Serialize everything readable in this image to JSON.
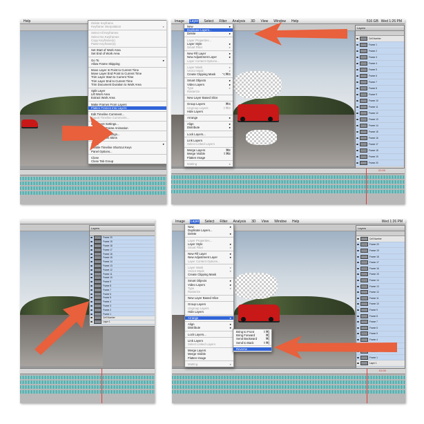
{
  "panel1": {
    "menu_items": [
      "Delete Keyframe",
      "Keyframe Interpolation",
      "Select All Keyframes",
      "Select No Keyframes",
      "Copy Keyframe(s)",
      "Paste Keyframe(s)",
      "Set Start of Work Area",
      "Set End of Work Area",
      "Go To",
      "Allow Frame Skipping",
      "Move Layer In Point to Current Time",
      "Move Layer End Point to Current Time",
      "Trim Layer Start to Current Time",
      "Trim Layer End to Current Time",
      "Trim Document Duration to Work Area",
      "Split Layer",
      "Lift Work Area",
      "Extract Work Area",
      "Make Frames From Layers",
      "Flatten Frames Into Layers",
      "Edit Timeline Comment...",
      "Export Timeline Comments...",
      "Document Settings...",
      "Convert to Frame Animation",
      "Onion Skin Settings...",
      "Enable Onion Skins",
      "Show",
      "Enable Timeline Shortcut Keys",
      "Panel Options...",
      "Close",
      "Close Tab Group"
    ],
    "highlighted": "Flatten Frames Into Layers"
  },
  "panel2": {
    "menubar": [
      "Image",
      "Layer",
      "Select",
      "Filter",
      "Analysis",
      "3D",
      "View",
      "Window",
      "Help"
    ],
    "active_menu": "Layer",
    "status_time": "Wed 1:26 PM",
    "status_size": "516 GB",
    "menu_items": [
      "New",
      "Duplicate Layers...",
      "Delete",
      "Layer Properties...",
      "Layer Style",
      "Smart Filter",
      "New Fill Layer",
      "New Adjustment Layer",
      "Layer Content Options...",
      "Layer Mask",
      "Vector Mask",
      "Create Clipping Mask",
      "Smart Objects",
      "Video Layers",
      "Type",
      "Rasterize",
      "New Layer Based Slice",
      "Group Layers",
      "Ungroup Layers",
      "Hide Layers",
      "Arrange",
      "Align",
      "Distribute",
      "Lock Layers...",
      "Link Layers",
      "Select Linked Layers",
      "Merge Layers",
      "Merge Visible",
      "Flatten Image",
      "Matting"
    ],
    "highlighted": "Duplicate Layers...",
    "shortcuts": {
      "Create Clipping Mask": "⌥⌘G",
      "Group Layers": "⌘G",
      "Ungroup Layers": "⇧⌘G",
      "Merge Layers": "⌘E",
      "Merge Visible": "⇧⌘E"
    },
    "layers": [
      "Cell Number",
      "Frame 1",
      "Frame 2",
      "Frame 3",
      "Frame 4",
      "Frame 5",
      "Frame 6",
      "Frame 7",
      "Frame 8",
      "Frame 9",
      "Frame 10",
      "Frame 11",
      "Frame 12",
      "Frame 13",
      "Frame 14",
      "Frame 15",
      "Frame 16",
      "Frame 17",
      "Frame 18",
      "Frame 19",
      "Frame 20"
    ],
    "timecode": "01:00"
  },
  "panel3": {
    "layers": [
      "Frame 20",
      "Frame 19",
      "Frame 18",
      "Frame 17",
      "Frame 16",
      "Frame 15",
      "Frame 14",
      "Frame 13",
      "Frame 12",
      "Frame 11",
      "Frame 10",
      "Frame 9",
      "Frame 8",
      "Frame 7",
      "Frame 6",
      "Frame 5",
      "Frame 4",
      "Frame 3",
      "Frame 2",
      "Frame 1",
      "Cell Number",
      "Layer 1"
    ]
  },
  "panel4": {
    "menubar": [
      "Image",
      "Layer",
      "Select",
      "Filter",
      "Analysis",
      "3D",
      "View",
      "Window",
      "Help"
    ],
    "active_menu": "Layer",
    "status_time": "Wed 1:26 PM",
    "menu_items": [
      "New",
      "Duplicate Layers...",
      "Delete",
      "Layer Properties...",
      "Layer Style",
      "Smart Filter",
      "New Fill Layer",
      "New Adjustment Layer",
      "Layer Content Options...",
      "Layer Mask",
      "Vector Mask",
      "Create Clipping Mask",
      "Smart Objects",
      "Video Layers",
      "Type",
      "Rasterize",
      "New Layer Based Slice",
      "Group Layers",
      "Ungroup Layers",
      "Hide Layers",
      "Arrange",
      "Align",
      "Distribute",
      "Lock Layers...",
      "Link Layers",
      "Select Linked Layers",
      "Merge Layers",
      "Merge Visible",
      "Flatten Image",
      "Matting"
    ],
    "highlighted": "Arrange",
    "submenu": [
      "Bring to Front",
      "Bring Forward",
      "Send Backward",
      "Send to Back",
      "Reverse"
    ],
    "submenu_shortcuts": [
      "⇧⌘]",
      "⌘]",
      "⌘[",
      "⇧⌘[",
      ""
    ],
    "submenu_highlighted": "Reverse",
    "layers": [
      "Cell Number",
      "Frame 20",
      "Frame 19",
      "Frame 18",
      "Frame 17",
      "Frame 16",
      "Frame 15",
      "Frame 14",
      "Frame 13",
      "Frame 12",
      "Frame 11",
      "Frame 10",
      "Frame 9",
      "Frame 8",
      "Frame 7",
      "Frame 6",
      "Frame 5",
      "Frame 4",
      "Frame 3",
      "Frame 2",
      "Frame 1",
      "Layer 1"
    ],
    "timecode": "01:00"
  },
  "colors": {
    "arrow": "#e8603c",
    "highlight": "#3064d8",
    "layer_selected": "#9ebbe6"
  }
}
